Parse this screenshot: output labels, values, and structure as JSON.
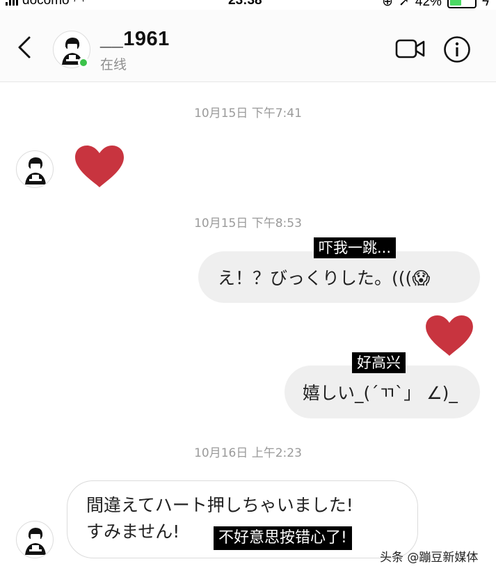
{
  "status_bar": {
    "carrier": "docomo",
    "time": "23:38",
    "battery_percent": "42%"
  },
  "header": {
    "username": "__1961",
    "status": "在线",
    "online_color": "#3cc34b",
    "icons": [
      "back-chevron-icon",
      "video-call-icon",
      "info-icon"
    ]
  },
  "messages": {
    "ts1": "10月15日 下午7:41",
    "ts2": "10月15日 下午8:53",
    "msg2": "え！？びっくりした。(((😱",
    "cap2": "吓我一跳...",
    "cap4": "好高兴",
    "msg4": "嬉しい_(´ㄲ`」 ∠)_",
    "ts3": "10月16日 上午2:23",
    "msg5_line1": "間違えてハート押しちゃいました!",
    "msg5_line2": "すみません!",
    "cap5": "不好意思按错心了!"
  },
  "heart_color": "#c8343f",
  "watermark": "头条 @蹦豆新媒体"
}
